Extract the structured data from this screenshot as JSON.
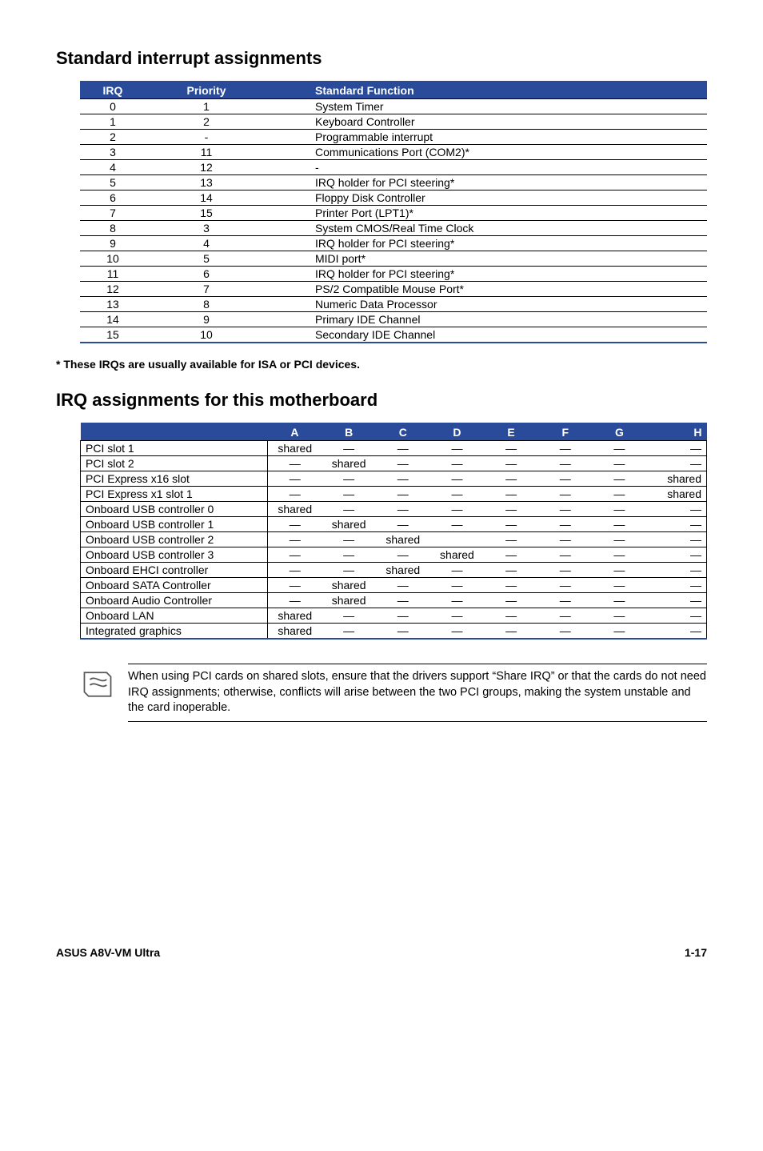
{
  "headings": {
    "h1": "Standard interrupt assignments",
    "h2": "IRQ assignments for this motherboard"
  },
  "t1": {
    "headers": {
      "irq": "IRQ",
      "pri": "Priority",
      "func": "Standard Function"
    },
    "rows": [
      {
        "irq": "0",
        "pri": "1",
        "func": "System Timer"
      },
      {
        "irq": "1",
        "pri": "2",
        "func": "Keyboard Controller"
      },
      {
        "irq": "2",
        "pri": "-",
        "func": "Programmable interrupt"
      },
      {
        "irq": "3",
        "pri": "11",
        "func": "Communications Port (COM2)*"
      },
      {
        "irq": "4",
        "pri": "12",
        "func": "-"
      },
      {
        "irq": "5",
        "pri": "13",
        "func": "IRQ holder for PCI steering*"
      },
      {
        "irq": "6",
        "pri": "14",
        "func": "Floppy Disk Controller"
      },
      {
        "irq": "7",
        "pri": "15",
        "func": "Printer Port (LPT1)*"
      },
      {
        "irq": "8",
        "pri": "3",
        "func": "System CMOS/Real Time Clock"
      },
      {
        "irq": "9",
        "pri": "4",
        "func": "IRQ holder for PCI steering*"
      },
      {
        "irq": "10",
        "pri": "5",
        "func": "MIDI port*"
      },
      {
        "irq": "11",
        "pri": "6",
        "func": "IRQ holder for PCI steering*"
      },
      {
        "irq": "12",
        "pri": "7",
        "func": "PS/2 Compatible Mouse Port*"
      },
      {
        "irq": "13",
        "pri": "8",
        "func": "Numeric Data Processor"
      },
      {
        "irq": "14",
        "pri": "9",
        "func": "Primary IDE Channel"
      },
      {
        "irq": "15",
        "pri": "10",
        "func": "Secondary IDE Channel"
      }
    ]
  },
  "footnote": "* These IRQs are usually available for ISA or PCI devices.",
  "t2": {
    "cols": [
      "A",
      "B",
      "C",
      "D",
      "E",
      "F",
      "G",
      "H"
    ],
    "rows": [
      {
        "name": "PCI slot 1",
        "vals": [
          "shared",
          "—",
          "—",
          "—",
          "—",
          "—",
          "—",
          "—"
        ]
      },
      {
        "name": "PCI slot 2",
        "vals": [
          "—",
          "shared",
          "—",
          "—",
          "—",
          "—",
          "—",
          "—"
        ]
      },
      {
        "name": "PCI Express x16 slot",
        "vals": [
          "—",
          "—",
          "—",
          "—",
          "—",
          "—",
          "—",
          "shared"
        ]
      },
      {
        "name": "PCI Express x1 slot 1",
        "vals": [
          "—",
          "—",
          "—",
          "—",
          "—",
          "—",
          "—",
          "shared"
        ]
      },
      {
        "name": "Onboard USB controller 0",
        "vals": [
          "shared",
          "—",
          "—",
          "—",
          "—",
          "—",
          "—",
          "—"
        ]
      },
      {
        "name": "Onboard USB controller 1",
        "vals": [
          "—",
          "shared",
          "—",
          "—",
          "—",
          "—",
          "—",
          "—"
        ]
      },
      {
        "name": "Onboard USB controller 2",
        "vals": [
          "—",
          "—",
          "shared",
          "",
          "—",
          "—",
          "—",
          "—"
        ]
      },
      {
        "name": "Onboard USB controller 3",
        "vals": [
          "—",
          "—",
          "—",
          "shared",
          "—",
          "—",
          "—",
          "—"
        ]
      },
      {
        "name": "Onboard EHCI controller",
        "vals": [
          "—",
          "—",
          "shared",
          "—",
          "—",
          "—",
          "—",
          "—"
        ]
      },
      {
        "name": "Onboard SATA Controller",
        "vals": [
          "—",
          "shared",
          "—",
          "—",
          "—",
          "—",
          "—",
          "—"
        ]
      },
      {
        "name": "Onboard Audio Controller",
        "vals": [
          "—",
          "shared",
          "—",
          "—",
          "—",
          "—",
          "—",
          "—"
        ]
      },
      {
        "name": "Onboard LAN",
        "vals": [
          "shared",
          "—",
          "—",
          "—",
          "—",
          "—",
          "—",
          "—"
        ]
      },
      {
        "name": "Integrated graphics",
        "vals": [
          "shared",
          "—",
          "—",
          "—",
          "—",
          "—",
          "—",
          "—"
        ]
      }
    ]
  },
  "callout": "When using PCI cards on shared slots, ensure that the drivers support “Share IRQ” or that the cards do not need IRQ assignments; otherwise, conflicts will arise between the two PCI groups, making the system unstable and the card inoperable.",
  "footer": {
    "model": "ASUS A8V-VM Ultra",
    "page": "1-17"
  }
}
